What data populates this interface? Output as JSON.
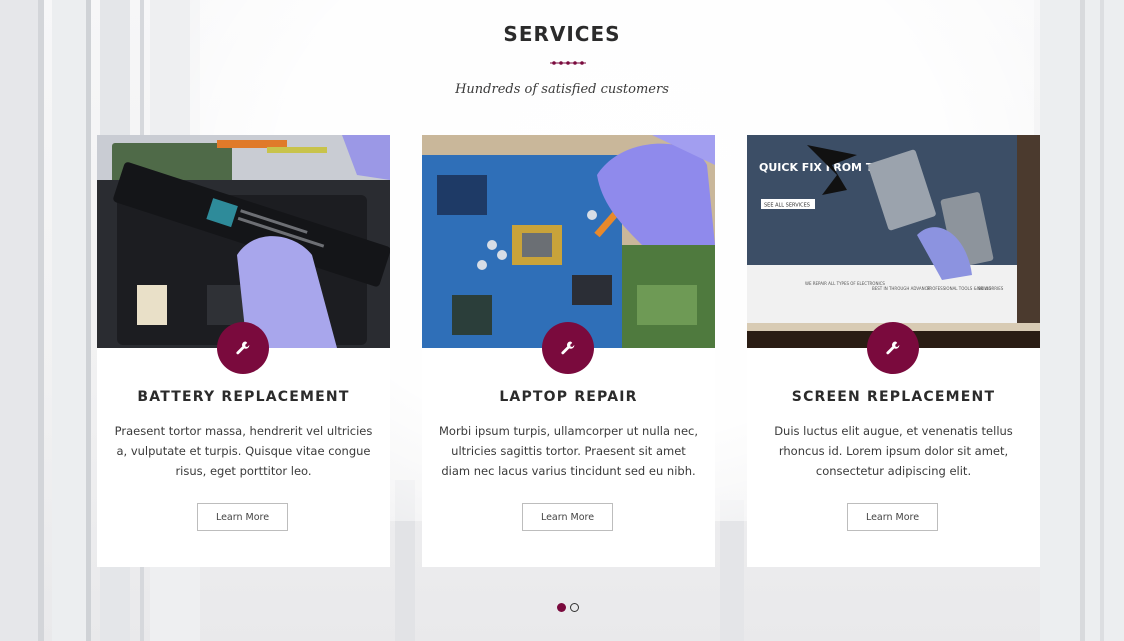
{
  "section": {
    "title": "SERVICES",
    "subtitle": "Hundreds of satisfied customers"
  },
  "colors": {
    "accent": "#7a0a3d",
    "heading": "#2b2b2b",
    "text": "#3a3a3a"
  },
  "cards": [
    {
      "title": "BATTERY REPLACEMENT",
      "description": "Praesent tortor massa, hendrerit vel ultricies a, vulputate et turpis. Quisque vitae congue risus, eget porttitor leo.",
      "button": "Learn More",
      "icon": "wrench-icon",
      "image": "laptop-battery-photo"
    },
    {
      "title": "LAPTOP REPAIR",
      "description": "Morbi ipsum turpis, ullamcorper ut nulla nec, ultricies sagittis tortor. Praesent sit amet diam nec lacus varius tincidunt sed eu nibh.",
      "button": "Learn More",
      "icon": "wrench-icon",
      "image": "circuit-board-repair-photo"
    },
    {
      "title": "SCREEN REPLACEMENT",
      "description": "Duis luctus elit augue, et venenatis tellus rhoncus id. Lorem ipsum dolor sit amet, consectetur adipiscing elit.",
      "button": "Learn More",
      "icon": "wrench-icon",
      "image": "cracked-laptop-screen-photo"
    }
  ],
  "screen_photo": {
    "headline": "QUICK FIX FROM THE...",
    "cta": "SEE ALL SERVICES",
    "features": [
      "WE REPAIR ALL TYPES OF ELECTRONICS",
      "BEST IN THROUGH ADVANCE",
      "PROFESSIONAL TOOLS & SKILLS",
      "NO WORRIES"
    ]
  },
  "pagination": {
    "current": 1,
    "total": 2
  }
}
